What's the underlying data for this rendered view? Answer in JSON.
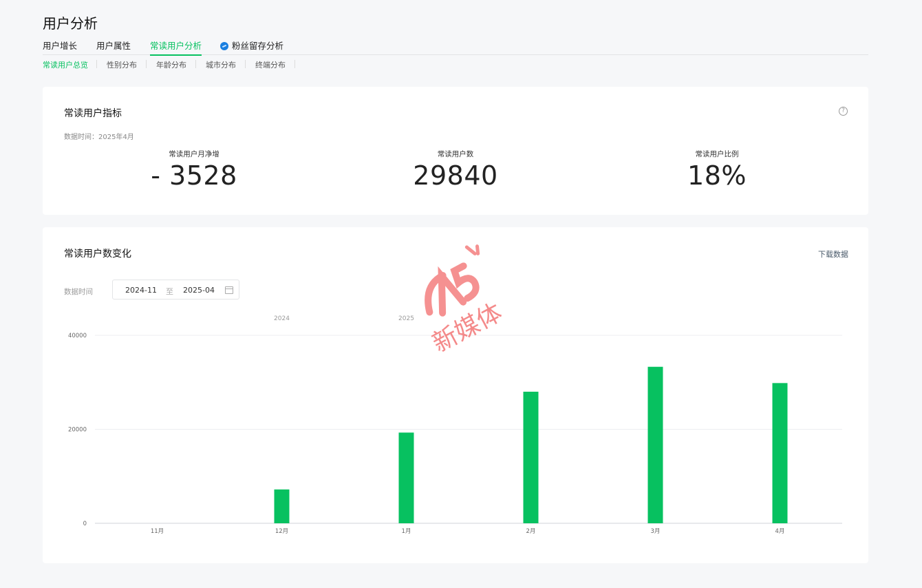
{
  "page": {
    "title": "用户分析"
  },
  "tabs": [
    {
      "label": "用户增长",
      "active": false
    },
    {
      "label": "用户属性",
      "active": false
    },
    {
      "label": "常读用户分析",
      "active": true
    },
    {
      "label": "粉丝留存分析",
      "active": false,
      "icon": "blue-badge-icon"
    }
  ],
  "subtabs": [
    {
      "label": "常读用户总览",
      "active": true
    },
    {
      "label": "性别分布",
      "active": false
    },
    {
      "label": "年龄分布",
      "active": false
    },
    {
      "label": "城市分布",
      "active": false
    },
    {
      "label": "终端分布",
      "active": false
    }
  ],
  "metrics_card": {
    "title": "常读用户指标",
    "data_time": "数据时间：2025年4月",
    "metrics": [
      {
        "label": "常读用户月净增",
        "value": "- 3528"
      },
      {
        "label": "常读用户数",
        "value": "29840"
      },
      {
        "label": "常读用户比例",
        "value": "18%"
      }
    ]
  },
  "trend_card": {
    "title": "常读用户数变化",
    "download_label": "下载数据",
    "date_label": "数据时间",
    "date_start": "2024-11",
    "date_to": "至",
    "date_end": "2025-04"
  },
  "chart_data": {
    "type": "bar",
    "categories": [
      "11月",
      "12月",
      "1月",
      "2月",
      "3月",
      "4月"
    ],
    "year_labels": [
      {
        "label": "2024",
        "at_category": 1
      },
      {
        "label": "2025",
        "at_category": 2
      }
    ],
    "values": [
      0,
      7200,
      19300,
      28000,
      33300,
      29840
    ],
    "yticks": [
      0,
      20000,
      40000
    ],
    "ylim": [
      0,
      40000
    ],
    "grid": true,
    "color": "#07c160"
  },
  "watermark": {
    "brand": "A5",
    "text": "新媒体",
    "color": "#f26d6d"
  },
  "colors": {
    "accent": "#07c160",
    "background": "#f6f7f9"
  }
}
